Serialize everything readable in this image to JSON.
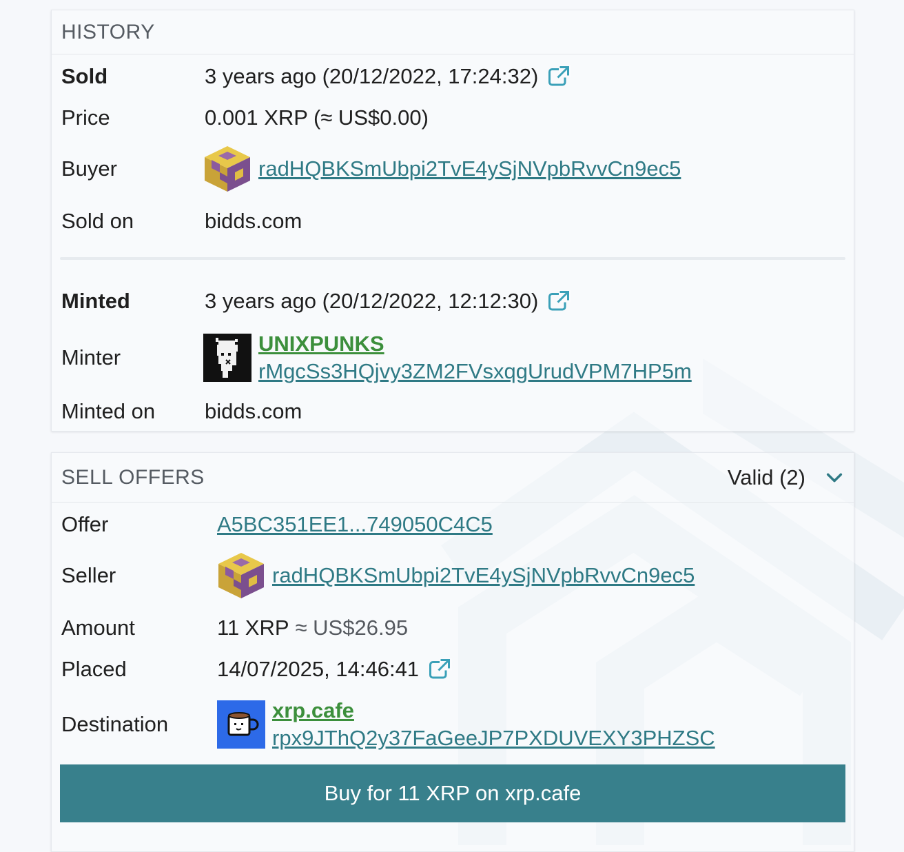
{
  "history": {
    "title": "HISTORY",
    "sold": {
      "label": "Sold",
      "value": "3 years ago (20/12/2022, 17:24:32)"
    },
    "price": {
      "label": "Price",
      "value": "0.001 XRP (≈ US$0.00)"
    },
    "buyer": {
      "label": "Buyer",
      "address": "radHQBKSmUbpi2TvE4ySjNVpbRvvCn9ec5"
    },
    "sold_on": {
      "label": "Sold on",
      "value": "bidds.com"
    },
    "minted": {
      "label": "Minted",
      "value": "3 years ago (20/12/2022, 12:12:30)"
    },
    "minter": {
      "label": "Minter",
      "name": "UNIXPUNKS",
      "address": "rMgcSs3HQjvy3ZM2FVsxqgUrudVPM7HP5m"
    },
    "minted_on": {
      "label": "Minted on",
      "value": "bidds.com"
    }
  },
  "sell_offers": {
    "title": "SELL OFFERS",
    "filter_value": "Valid (2)",
    "offer": {
      "label": "Offer",
      "value": "A5BC351EE1...749050C4C5"
    },
    "seller": {
      "label": "Seller",
      "address": "radHQBKSmUbpi2TvE4ySjNVpbRvvCn9ec5"
    },
    "amount": {
      "label": "Amount",
      "xrp": "11 XRP",
      "usd": "≈ US$26.95"
    },
    "placed": {
      "label": "Placed",
      "value": "14/07/2025, 14:46:41"
    },
    "destination": {
      "label": "Destination",
      "name": "xrp.cafe",
      "address": "rpx9JThQ2y37FaGeeJP7PXDUVEXY3PHZSC"
    },
    "buy_button": "Buy for 11 XRP on xrp.cafe"
  },
  "colors": {
    "link": "#2f7a85",
    "verified_name": "#3c8f3c",
    "button_bg": "#38808c",
    "external_icon": "#3aa0b8"
  },
  "icons": {
    "external": "external-link-icon",
    "chevron": "chevron-down-icon"
  }
}
